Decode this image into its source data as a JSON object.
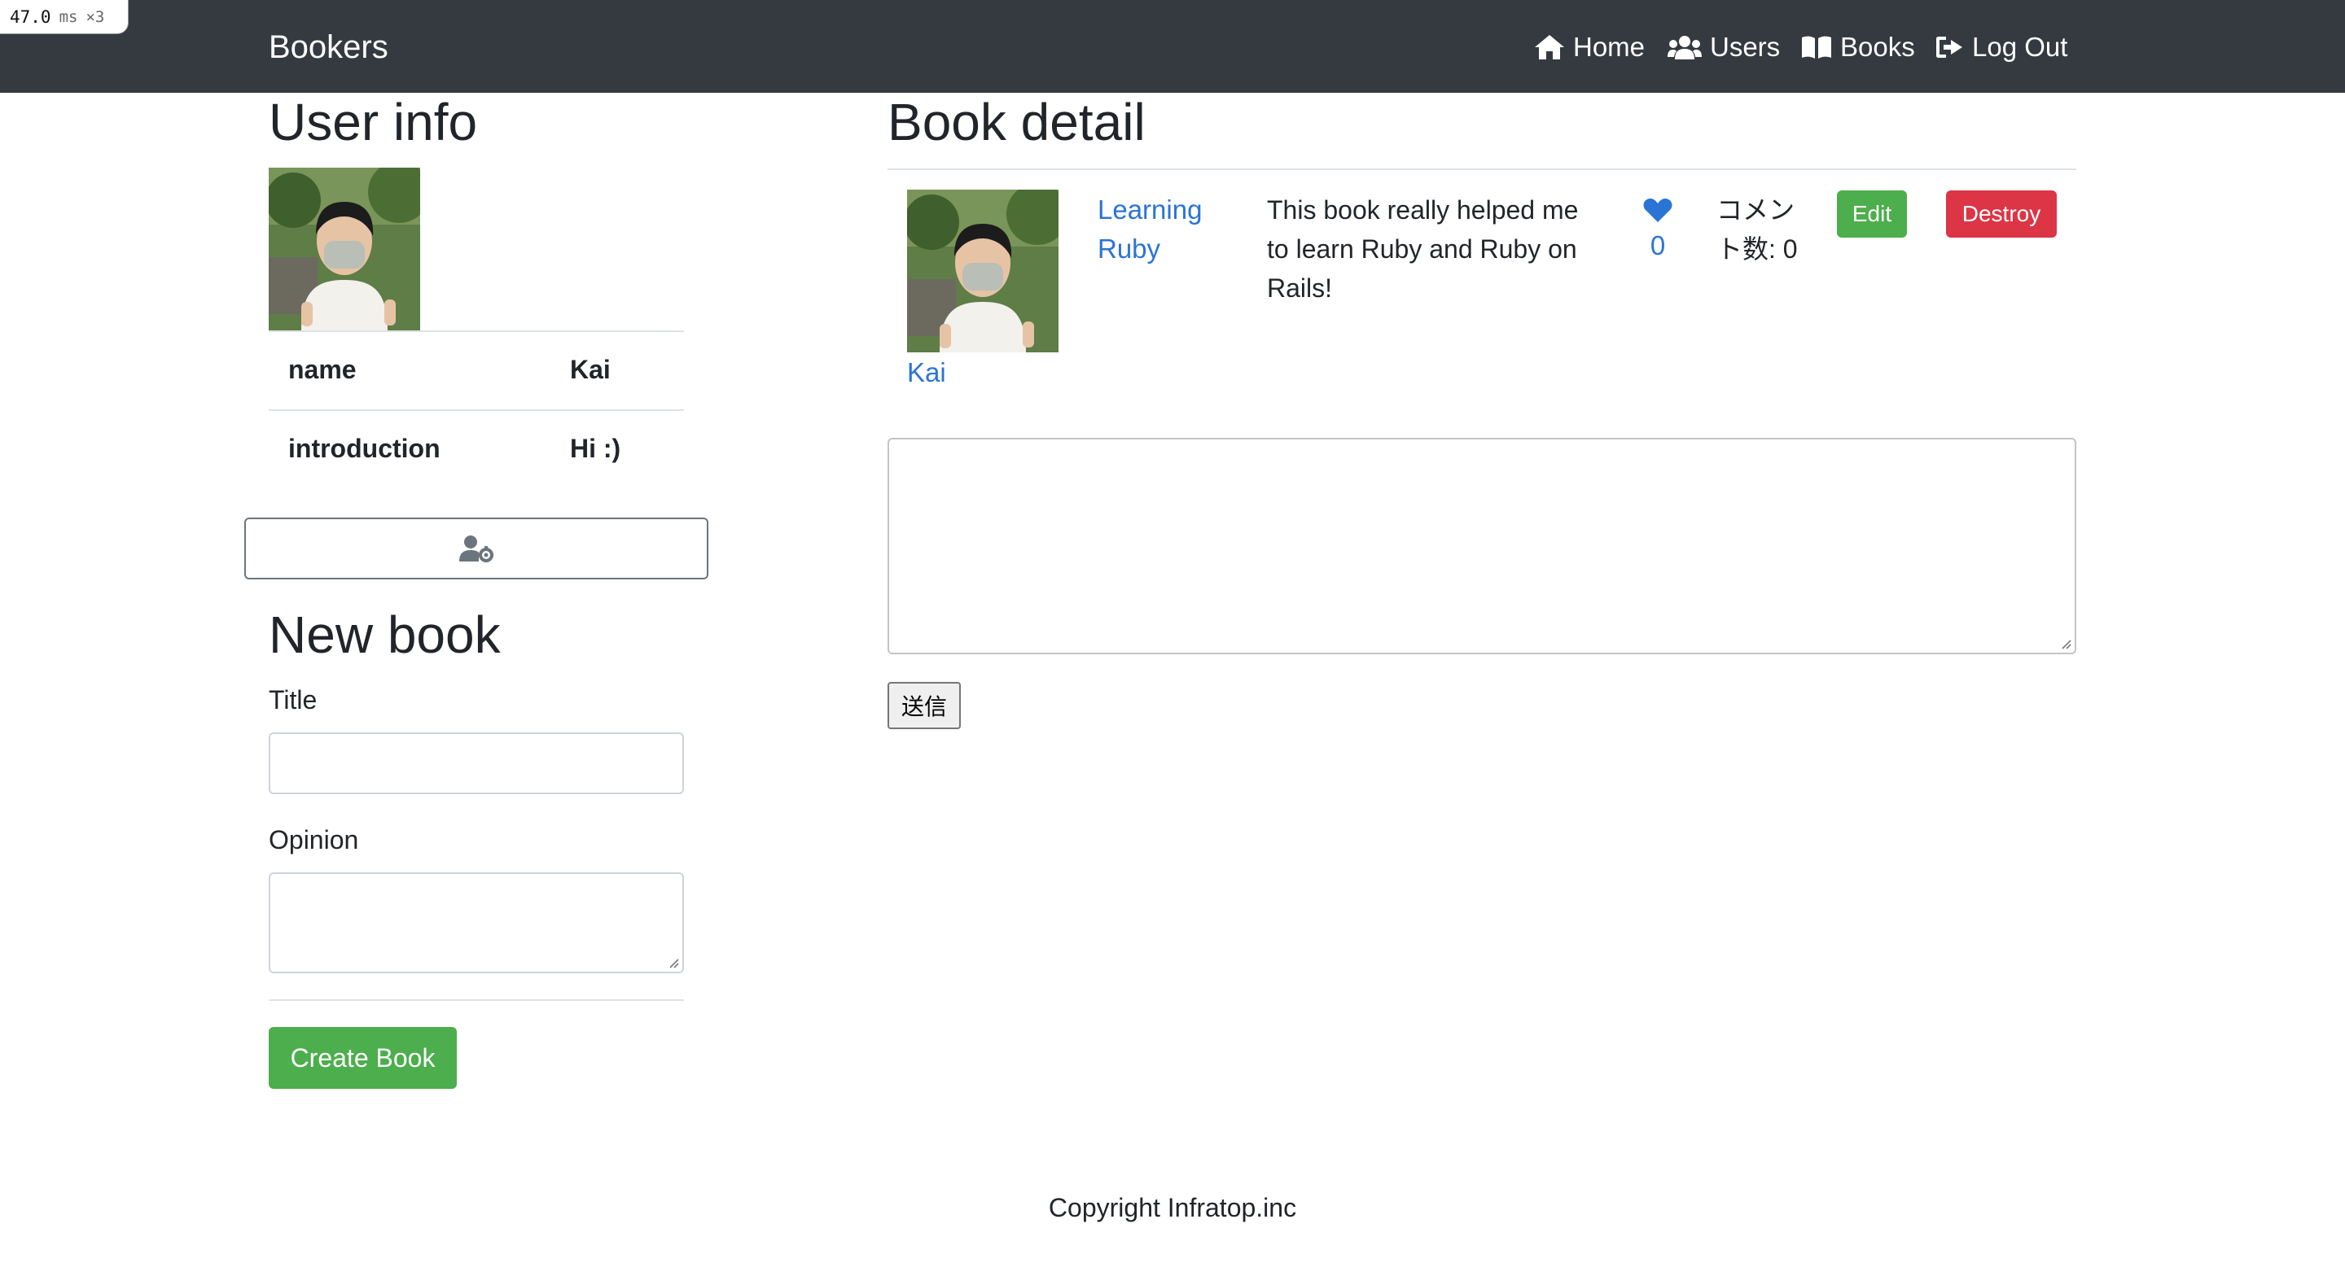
{
  "perf_badge": {
    "value": "47.0",
    "unit": "ms",
    "multiplier": "×3"
  },
  "navbar": {
    "brand": "Bookers",
    "links": [
      {
        "label": "Home",
        "icon": "home-icon"
      },
      {
        "label": "Users",
        "icon": "users-icon"
      },
      {
        "label": "Books",
        "icon": "book-open-icon"
      },
      {
        "label": "Log Out",
        "icon": "sign-out-icon"
      }
    ],
    "background": "#343a40"
  },
  "user_info": {
    "heading": "User info",
    "avatar": "user-photo",
    "rows": [
      {
        "key": "name",
        "value": "Kai"
      },
      {
        "key": "introduction",
        "value": "Hi :)"
      }
    ],
    "settings_icon": "user-cog-icon"
  },
  "new_book": {
    "heading": "New book",
    "title_label": "Title",
    "title_value": "",
    "opinion_label": "Opinion",
    "opinion_value": "",
    "submit_label": "Create Book"
  },
  "book_detail": {
    "heading": "Book detail",
    "user_name": "Kai",
    "title_line1": "Learning",
    "title_line2": "Ruby",
    "body_line1": "This book really helped me",
    "body_line2": "to learn Ruby and Ruby on",
    "body_line3": "Rails!",
    "favorite_count": "0",
    "comment_label_line1": "コメン",
    "comment_label_line2": "ト数: 0",
    "edit_label": "Edit",
    "destroy_label": "Destroy",
    "comment_value": "",
    "comment_submit_label": "送信"
  },
  "footer": {
    "text": "Copyright Infratop.inc"
  },
  "colors": {
    "link": "#2a74d6",
    "success": "#4cae4c",
    "danger": "#dc3545"
  }
}
